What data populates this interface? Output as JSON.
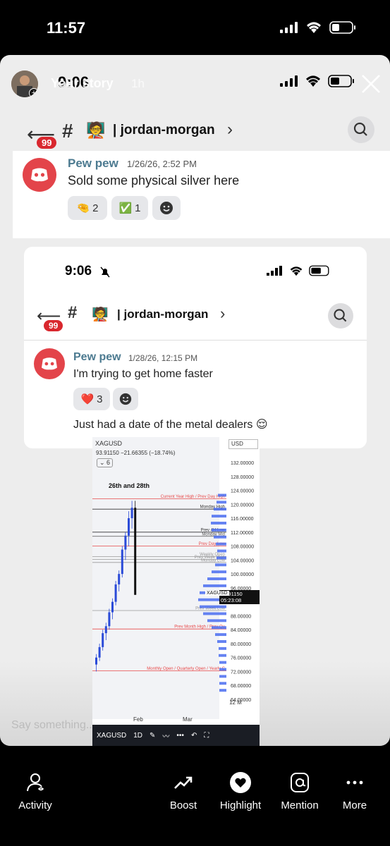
{
  "status_bar": {
    "time": "11:57"
  },
  "story": {
    "username": "Your story",
    "age": "1h",
    "inner_time": "9:06"
  },
  "channel": {
    "badge": "99",
    "emoji": "🧑‍🏫",
    "name": "| jordan-morgan",
    "chevron": "›"
  },
  "message_1": {
    "author": "Pew pew",
    "timestamp": "1/26/26, 2:52 PM",
    "text": "Sold some physical silver here",
    "reactions": [
      {
        "emoji": "🤏",
        "count": "2"
      },
      {
        "emoji": "✅",
        "count": "1"
      }
    ]
  },
  "nested": {
    "time": "9:06",
    "badge": "99",
    "channel_name": "| jordan-morgan",
    "message": {
      "author": "Pew pew",
      "timestamp": "1/28/26, 12:15 PM",
      "text": "I'm trying to get home faster",
      "reaction": {
        "emoji": "❤️",
        "count": "3"
      },
      "text2": "Just had a date of the metal dealers 😌"
    }
  },
  "chart_data": {
    "type": "candlestick",
    "symbol": "XAGUSD",
    "currency": "USD",
    "quote": "93.91150  −21.66355 (−18.74%)",
    "interval_badge": "6",
    "annotation": "26th and 28th",
    "price_label": "93.91150",
    "countdown": "05:23:08",
    "timeframe": "1D",
    "x_ticks": [
      "Feb",
      "Mar"
    ],
    "y_ticks": [
      "132.00000",
      "128.00000",
      "124.00000",
      "120.00000",
      "116.00000",
      "112.00000",
      "108.00000",
      "104.00000",
      "100.00000",
      "96.00000",
      "92.00000",
      "88.00000",
      "84.00000",
      "80.00000",
      "76.00000",
      "72.00000",
      "68.00000",
      "64.00000"
    ],
    "ylim": [
      64,
      132
    ],
    "levels": [
      {
        "label": "Current Year High / Prev Day High",
        "value": 121.6,
        "color": "#e84a4a"
      },
      {
        "label": "Monday High",
        "value": 118.6,
        "color": "#333333"
      },
      {
        "label": "Prev 4H Low",
        "value": 112.0,
        "color": "#333333"
      },
      {
        "label": "Monday Mid",
        "value": 110.8,
        "color": "#555555"
      },
      {
        "label": "Prev Day Low",
        "value": 108.0,
        "color": "#e84a4a"
      },
      {
        "label": "Weekly Open",
        "value": 105.0,
        "color": "#999999"
      },
      {
        "label": "Prev Week High",
        "value": 104.2,
        "color": "#999999"
      },
      {
        "label": "Monday Low",
        "value": 103.3,
        "color": "#999999"
      },
      {
        "label": "Prev Week Low",
        "value": 89.5,
        "color": "#999999"
      },
      {
        "label": "Prev Month High / Prev Qu",
        "value": 84.2,
        "color": "#e84a4a"
      },
      {
        "label": "Monthly Open / Quarterly Open / Yearly C",
        "value": 72.2,
        "color": "#e84a4a"
      }
    ],
    "volume_label": "12 M",
    "toolbar_symbol": "XAGUSD",
    "toolbar_timeframe": "1D"
  },
  "input": {
    "placeholder": "Say something..."
  },
  "bottom_bar": {
    "items": [
      "Activity",
      "Boost",
      "Highlight",
      "Mention",
      "More"
    ]
  },
  "colors": {
    "discord_red": "#e3444a",
    "badge_red": "#d9272e",
    "bar_blue": "#4a6cf0"
  }
}
